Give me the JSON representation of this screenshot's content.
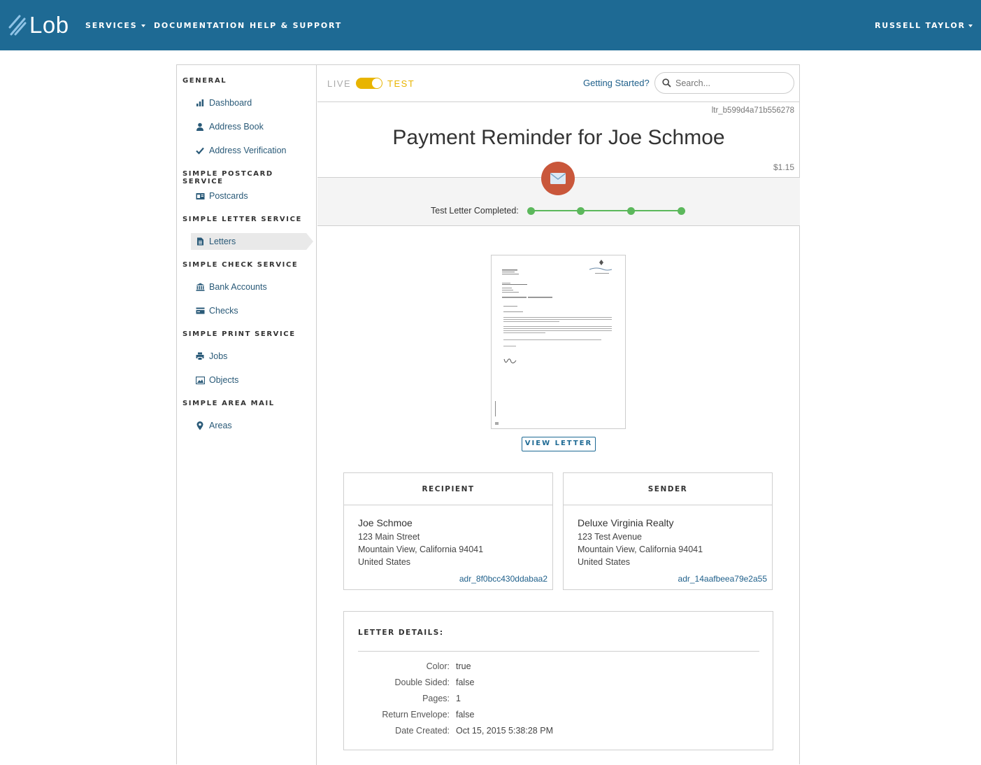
{
  "topnav": {
    "brand": "Lob",
    "services": "SERVICES",
    "documentation": "DOCUMENTATION",
    "help": "HELP & SUPPORT",
    "user": "RUSSELL TAYLOR"
  },
  "sidebar": {
    "general": "GENERAL",
    "dashboard": "Dashboard",
    "address_book": "Address Book",
    "address_verification": "Address Verification",
    "postcard_service": "SIMPLE POSTCARD SERVICE",
    "postcards": "Postcards",
    "letter_service": "SIMPLE LETTER SERVICE",
    "letters": "Letters",
    "check_service": "SIMPLE CHECK SERVICE",
    "bank_accounts": "Bank Accounts",
    "checks": "Checks",
    "print_service": "SIMPLE PRINT SERVICE",
    "jobs": "Jobs",
    "objects": "Objects",
    "area_mail": "SIMPLE AREA MAIL",
    "areas": "Areas"
  },
  "toolbar": {
    "live": "LIVE",
    "test": "TEST",
    "getting_started": "Getting Started?",
    "search_placeholder": "Search..."
  },
  "letter": {
    "id": "ltr_b599d4a71b556278",
    "title": "Payment Reminder for Joe Schmoe",
    "price": "$1.15",
    "status_label": "Test Letter Completed:",
    "view_button": "VIEW LETTER"
  },
  "recipient": {
    "header": "RECIPIENT",
    "name": "Joe Schmoe",
    "line1": "123 Main Street",
    "line2": "Mountain View, California 94041",
    "line3": "United States",
    "id": "adr_8f0bcc430ddabaa2"
  },
  "sender": {
    "header": "SENDER",
    "name": "Deluxe Virginia Realty",
    "line1": "123 Test Avenue",
    "line2": "Mountain View, California 94041",
    "line3": "United States",
    "id": "adr_14aafbeea79e2a55"
  },
  "details": {
    "title": "LETTER DETAILS:",
    "color_label": "Color:",
    "color_value": "true",
    "double_sided_label": "Double Sided:",
    "double_sided_value": "false",
    "pages_label": "Pages:",
    "pages_value": "1",
    "return_envelope_label": "Return Envelope:",
    "return_envelope_value": "false",
    "date_created_label": "Date Created:",
    "date_created_value": "Oct 15, 2015 5:38:28 PM"
  },
  "colors": {
    "nav": "#1e6a94",
    "toggle": "#e8b400",
    "status": "#5cb85c",
    "envelope": "#c9573b"
  }
}
